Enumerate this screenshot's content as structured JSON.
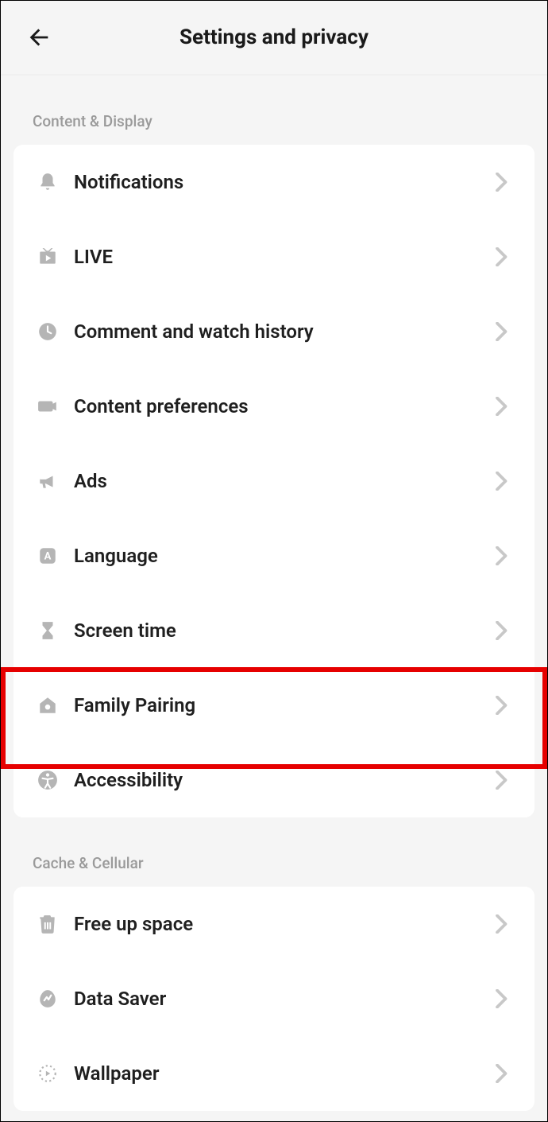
{
  "header": {
    "title": "Settings and privacy"
  },
  "sections": [
    {
      "title": "Content & Display",
      "items": [
        {
          "icon": "bell-icon",
          "label": "Notifications"
        },
        {
          "icon": "live-icon",
          "label": "LIVE"
        },
        {
          "icon": "clock-icon",
          "label": "Comment and watch history"
        },
        {
          "icon": "video-icon",
          "label": "Content preferences"
        },
        {
          "icon": "megaphone-icon",
          "label": "Ads"
        },
        {
          "icon": "language-icon",
          "label": "Language"
        },
        {
          "icon": "hourglass-icon",
          "label": "Screen time"
        },
        {
          "icon": "house-icon",
          "label": "Family Pairing",
          "highlighted": true
        },
        {
          "icon": "accessibility-icon",
          "label": "Accessibility"
        }
      ]
    },
    {
      "title": "Cache & Cellular",
      "items": [
        {
          "icon": "trash-icon",
          "label": "Free up space"
        },
        {
          "icon": "data-saver-icon",
          "label": "Data Saver"
        },
        {
          "icon": "wallpaper-icon",
          "label": "Wallpaper"
        }
      ]
    }
  ]
}
